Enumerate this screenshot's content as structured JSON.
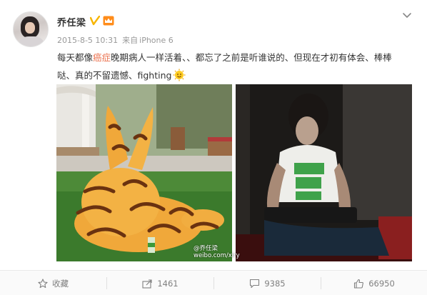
{
  "user": {
    "name": "乔任梁"
  },
  "meta": {
    "timestamp": "2015-8-5 10:31",
    "via_label": "来自",
    "source": "iPhone 6"
  },
  "post": {
    "text_before": "每天都像",
    "highlight": "癌症",
    "text_after": "晚期病人一样活着、、都忘了之前是听谁说的、但现在才初有体会、棒棒哒、真的不留遗憾、fighting"
  },
  "watermark": {
    "line1": "@乔任梁",
    "line2": "weibo.com/xiry"
  },
  "actions": {
    "favorite_label": "收藏",
    "repost_count": "1461",
    "comment_count": "9385",
    "like_count": "66950"
  },
  "colors": {
    "highlight": "#eb7350",
    "verified": "#f7b500",
    "text": "#333333",
    "meta": "#999999"
  }
}
